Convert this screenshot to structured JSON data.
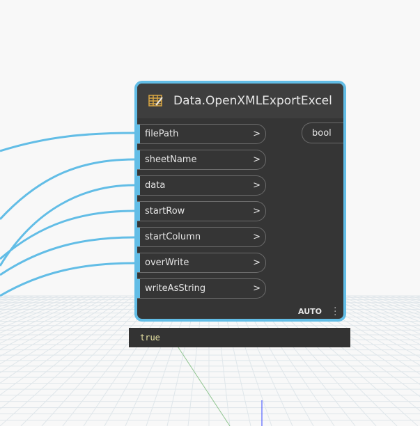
{
  "node": {
    "title": "Data.OpenXMLExportExcel",
    "icon": "excel-table-icon",
    "inputs": [
      {
        "label": "filePath",
        "arrow": ">"
      },
      {
        "label": "sheetName",
        "arrow": ">"
      },
      {
        "label": "data",
        "arrow": ">"
      },
      {
        "label": "startRow",
        "arrow": ">"
      },
      {
        "label": "startColumn",
        "arrow": ">"
      },
      {
        "label": "overWrite",
        "arrow": ">"
      },
      {
        "label": "writeAsString",
        "arrow": ">"
      }
    ],
    "output": "bool",
    "lacing": "AUTO",
    "accent": "#62bde6"
  },
  "preview": {
    "value": "true"
  }
}
